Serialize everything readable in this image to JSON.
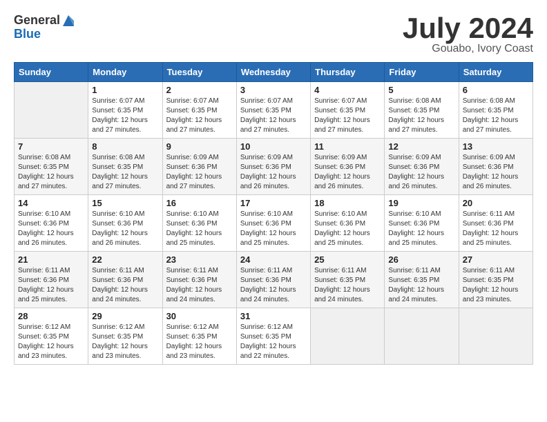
{
  "header": {
    "logo_general": "General",
    "logo_blue": "Blue",
    "title": "July 2024",
    "subtitle": "Gouabo, Ivory Coast"
  },
  "weekdays": [
    "Sunday",
    "Monday",
    "Tuesday",
    "Wednesday",
    "Thursday",
    "Friday",
    "Saturday"
  ],
  "weeks": [
    [
      {
        "day": "",
        "empty": true
      },
      {
        "day": "1",
        "sunrise": "Sunrise: 6:07 AM",
        "sunset": "Sunset: 6:35 PM",
        "daylight": "Daylight: 12 hours and 27 minutes."
      },
      {
        "day": "2",
        "sunrise": "Sunrise: 6:07 AM",
        "sunset": "Sunset: 6:35 PM",
        "daylight": "Daylight: 12 hours and 27 minutes."
      },
      {
        "day": "3",
        "sunrise": "Sunrise: 6:07 AM",
        "sunset": "Sunset: 6:35 PM",
        "daylight": "Daylight: 12 hours and 27 minutes."
      },
      {
        "day": "4",
        "sunrise": "Sunrise: 6:07 AM",
        "sunset": "Sunset: 6:35 PM",
        "daylight": "Daylight: 12 hours and 27 minutes."
      },
      {
        "day": "5",
        "sunrise": "Sunrise: 6:08 AM",
        "sunset": "Sunset: 6:35 PM",
        "daylight": "Daylight: 12 hours and 27 minutes."
      },
      {
        "day": "6",
        "sunrise": "Sunrise: 6:08 AM",
        "sunset": "Sunset: 6:35 PM",
        "daylight": "Daylight: 12 hours and 27 minutes."
      }
    ],
    [
      {
        "day": "7",
        "sunrise": "Sunrise: 6:08 AM",
        "sunset": "Sunset: 6:35 PM",
        "daylight": "Daylight: 12 hours and 27 minutes."
      },
      {
        "day": "8",
        "sunrise": "Sunrise: 6:08 AM",
        "sunset": "Sunset: 6:35 PM",
        "daylight": "Daylight: 12 hours and 27 minutes."
      },
      {
        "day": "9",
        "sunrise": "Sunrise: 6:09 AM",
        "sunset": "Sunset: 6:36 PM",
        "daylight": "Daylight: 12 hours and 27 minutes."
      },
      {
        "day": "10",
        "sunrise": "Sunrise: 6:09 AM",
        "sunset": "Sunset: 6:36 PM",
        "daylight": "Daylight: 12 hours and 26 minutes."
      },
      {
        "day": "11",
        "sunrise": "Sunrise: 6:09 AM",
        "sunset": "Sunset: 6:36 PM",
        "daylight": "Daylight: 12 hours and 26 minutes."
      },
      {
        "day": "12",
        "sunrise": "Sunrise: 6:09 AM",
        "sunset": "Sunset: 6:36 PM",
        "daylight": "Daylight: 12 hours and 26 minutes."
      },
      {
        "day": "13",
        "sunrise": "Sunrise: 6:09 AM",
        "sunset": "Sunset: 6:36 PM",
        "daylight": "Daylight: 12 hours and 26 minutes."
      }
    ],
    [
      {
        "day": "14",
        "sunrise": "Sunrise: 6:10 AM",
        "sunset": "Sunset: 6:36 PM",
        "daylight": "Daylight: 12 hours and 26 minutes."
      },
      {
        "day": "15",
        "sunrise": "Sunrise: 6:10 AM",
        "sunset": "Sunset: 6:36 PM",
        "daylight": "Daylight: 12 hours and 26 minutes."
      },
      {
        "day": "16",
        "sunrise": "Sunrise: 6:10 AM",
        "sunset": "Sunset: 6:36 PM",
        "daylight": "Daylight: 12 hours and 25 minutes."
      },
      {
        "day": "17",
        "sunrise": "Sunrise: 6:10 AM",
        "sunset": "Sunset: 6:36 PM",
        "daylight": "Daylight: 12 hours and 25 minutes."
      },
      {
        "day": "18",
        "sunrise": "Sunrise: 6:10 AM",
        "sunset": "Sunset: 6:36 PM",
        "daylight": "Daylight: 12 hours and 25 minutes."
      },
      {
        "day": "19",
        "sunrise": "Sunrise: 6:10 AM",
        "sunset": "Sunset: 6:36 PM",
        "daylight": "Daylight: 12 hours and 25 minutes."
      },
      {
        "day": "20",
        "sunrise": "Sunrise: 6:11 AM",
        "sunset": "Sunset: 6:36 PM",
        "daylight": "Daylight: 12 hours and 25 minutes."
      }
    ],
    [
      {
        "day": "21",
        "sunrise": "Sunrise: 6:11 AM",
        "sunset": "Sunset: 6:36 PM",
        "daylight": "Daylight: 12 hours and 25 minutes."
      },
      {
        "day": "22",
        "sunrise": "Sunrise: 6:11 AM",
        "sunset": "Sunset: 6:36 PM",
        "daylight": "Daylight: 12 hours and 24 minutes."
      },
      {
        "day": "23",
        "sunrise": "Sunrise: 6:11 AM",
        "sunset": "Sunset: 6:36 PM",
        "daylight": "Daylight: 12 hours and 24 minutes."
      },
      {
        "day": "24",
        "sunrise": "Sunrise: 6:11 AM",
        "sunset": "Sunset: 6:36 PM",
        "daylight": "Daylight: 12 hours and 24 minutes."
      },
      {
        "day": "25",
        "sunrise": "Sunrise: 6:11 AM",
        "sunset": "Sunset: 6:35 PM",
        "daylight": "Daylight: 12 hours and 24 minutes."
      },
      {
        "day": "26",
        "sunrise": "Sunrise: 6:11 AM",
        "sunset": "Sunset: 6:35 PM",
        "daylight": "Daylight: 12 hours and 24 minutes."
      },
      {
        "day": "27",
        "sunrise": "Sunrise: 6:11 AM",
        "sunset": "Sunset: 6:35 PM",
        "daylight": "Daylight: 12 hours and 23 minutes."
      }
    ],
    [
      {
        "day": "28",
        "sunrise": "Sunrise: 6:12 AM",
        "sunset": "Sunset: 6:35 PM",
        "daylight": "Daylight: 12 hours and 23 minutes."
      },
      {
        "day": "29",
        "sunrise": "Sunrise: 6:12 AM",
        "sunset": "Sunset: 6:35 PM",
        "daylight": "Daylight: 12 hours and 23 minutes."
      },
      {
        "day": "30",
        "sunrise": "Sunrise: 6:12 AM",
        "sunset": "Sunset: 6:35 PM",
        "daylight": "Daylight: 12 hours and 23 minutes."
      },
      {
        "day": "31",
        "sunrise": "Sunrise: 6:12 AM",
        "sunset": "Sunset: 6:35 PM",
        "daylight": "Daylight: 12 hours and 22 minutes."
      },
      {
        "day": "",
        "empty": true
      },
      {
        "day": "",
        "empty": true
      },
      {
        "day": "",
        "empty": true
      }
    ]
  ]
}
